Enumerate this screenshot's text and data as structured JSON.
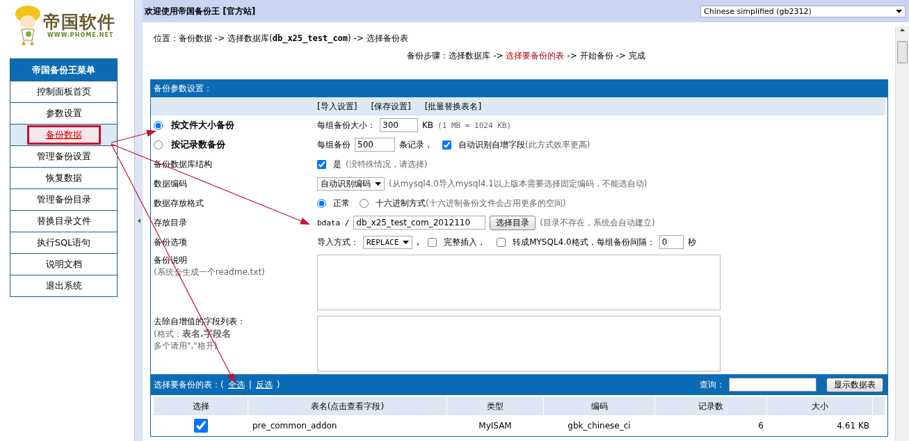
{
  "logo": {
    "name": "帝国软件",
    "url": "WWW.PHOME.NET"
  },
  "menu": {
    "title": "帝国备份王菜单",
    "items": [
      {
        "label": "控制面板首页",
        "selected": false
      },
      {
        "label": "参数设置",
        "selected": false
      },
      {
        "label": "备份数据",
        "selected": true
      },
      {
        "label": "管理备份设置",
        "selected": false
      },
      {
        "label": "恢复数据",
        "selected": false
      },
      {
        "label": "管理备份目录",
        "selected": false
      },
      {
        "label": "替换目录文件",
        "selected": false
      },
      {
        "label": "执行SQL语句",
        "selected": false
      },
      {
        "label": "说明文档",
        "selected": false
      },
      {
        "label": "退出系统",
        "selected": false
      }
    ]
  },
  "header": {
    "title": "欢迎使用帝国备份王",
    "link": "[官方站]",
    "language": "Chinese simplified (gb2312)"
  },
  "location": "位置：备份数据 -> 选择数据库(**db_x25_test_com**) -> 选择备份表",
  "steps": {
    "label": "备份步骤：",
    "items": [
      {
        "text": "选择数据库",
        "selected": false,
        "after": "->"
      },
      {
        "text": "选择要备份的表",
        "selected": true,
        "after": "->"
      },
      {
        "text": "开始备份",
        "selected": false,
        "after": "->"
      },
      {
        "text": "完成",
        "selected": false
      }
    ]
  },
  "settings": {
    "title": "备份参数设置：",
    "actions": [
      "[导入设置]",
      "[保存设置]",
      "[批量替换表名]"
    ],
    "by_size": {
      "label": "按文件大小备份",
      "selected": true,
      "field_label": "每组备份大小：",
      "value": "300",
      "unit": "KB",
      "note": "(1 MB = 1024 KB)"
    },
    "by_count": {
      "label": "按记录数备份",
      "selected": false,
      "field_label": "每组备份",
      "value": "500",
      "unit": "条记录，",
      "auto_checked": true,
      "auto_label": "自动识别自增字段",
      "note": "(此方式效率更高)"
    },
    "structure": {
      "label": "备份数据库结构",
      "checked": true,
      "option": "是",
      "note": "(没特殊情况，请选择)"
    },
    "encoding": {
      "label": "数据编码",
      "value": "自动识别编码",
      "note": "(从mysql4.0导入mysql4.1以上版本需要选择固定编码，不能选自动)"
    },
    "format": {
      "label": "数据存放格式",
      "options": [
        {
          "label": "正常",
          "selected": true
        },
        {
          "label": "十六进制方式",
          "selected": false
        }
      ],
      "note": "(十六进制备份文件会占用更多的空间)"
    },
    "directory": {
      "label": "存放目录",
      "prefix": "bdata /",
      "value": "db_x25_test_com_2012110",
      "button": "选择目录",
      "note": "(目录不存在，系统会自动建立)"
    },
    "options": {
      "label": "备份选项",
      "mode_label": "导入方式：",
      "mode": "REPLACE",
      "comma": ",",
      "complete_insert": {
        "checked": false,
        "label": "完整插入，"
      },
      "mysql40": {
        "checked": false,
        "label": "转成MYSQL4.0格式，每组备份间隔："
      },
      "interval": "0",
      "interval_unit": "秒"
    },
    "readme": {
      "label": "备份说明",
      "hint": "(系统会生成一个readme.txt)"
    },
    "strip_fields": {
      "label": "去除自增值的字段列表：",
      "hint_lines": [
        "(格式：**表名.字段名**",
        "多个请用\",\"格开)"
      ]
    }
  },
  "tables": {
    "title": "选择要备份的表：(",
    "select_all": "全选",
    "separator": "|",
    "invert": "反选",
    "close": ")",
    "search_label": "查询：",
    "search_button": "显示数据表",
    "columns": [
      "选择",
      "表名(点击查看字段)",
      "类型",
      "编码",
      "记录数",
      "大小"
    ],
    "rows": [
      {
        "checked": true,
        "name": "pre_common_addon",
        "type": "MyISAM",
        "collation": "gbk_chinese_ci",
        "records": "6",
        "size": "4.61 KB"
      }
    ]
  }
}
